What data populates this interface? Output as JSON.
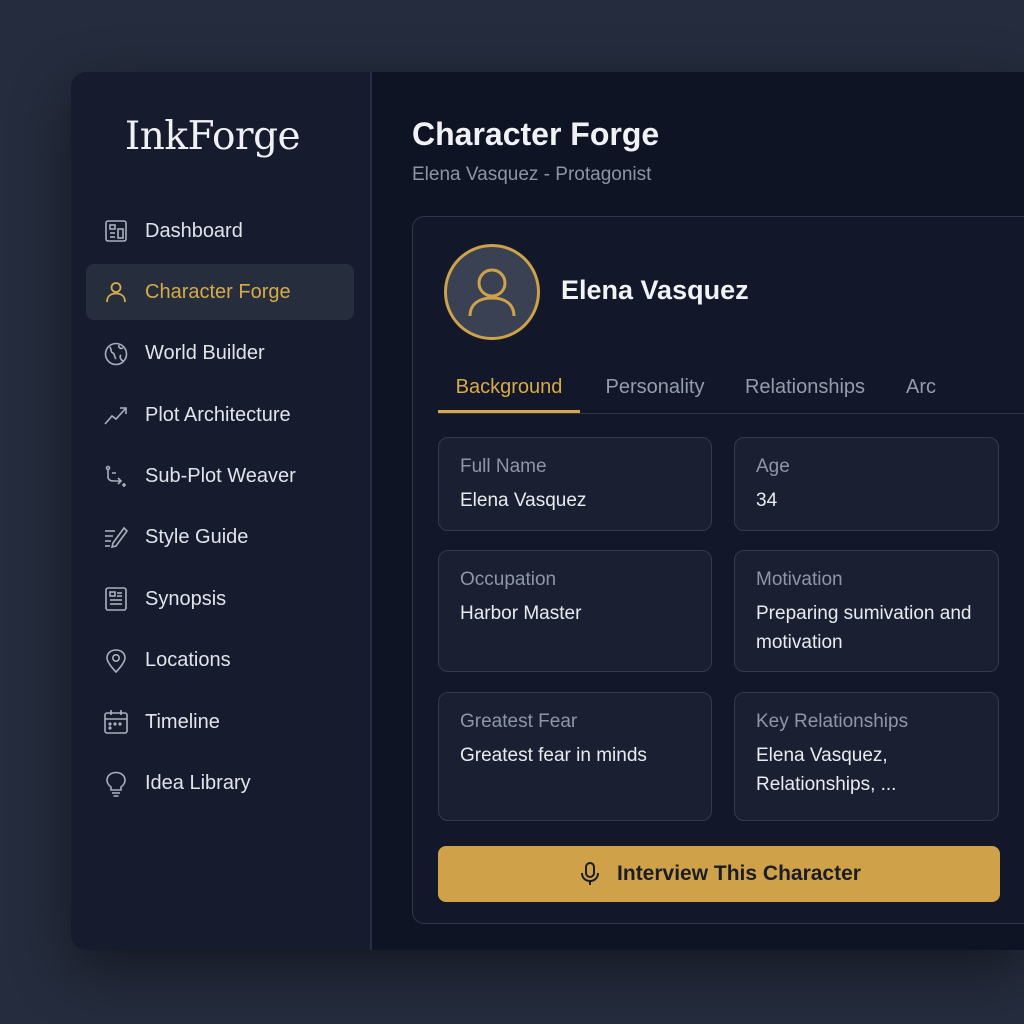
{
  "app": {
    "logo": "InkForge"
  },
  "sidebar": {
    "items": [
      {
        "label": "Dashboard",
        "icon": "dashboard-icon",
        "active": false
      },
      {
        "label": "Character Forge",
        "icon": "user-icon",
        "active": true
      },
      {
        "label": "World Builder",
        "icon": "globe-icon",
        "active": false
      },
      {
        "label": "Plot Architecture",
        "icon": "trend-line-icon",
        "active": false
      },
      {
        "label": "Sub-Plot Weaver",
        "icon": "branch-icon",
        "active": false
      },
      {
        "label": "Style Guide",
        "icon": "pen-lines-icon",
        "active": false
      },
      {
        "label": "Synopsis",
        "icon": "document-icon",
        "active": false
      },
      {
        "label": "Locations",
        "icon": "map-pin-icon",
        "active": false
      },
      {
        "label": "Timeline",
        "icon": "calendar-icon",
        "active": false
      },
      {
        "label": "Idea Library",
        "icon": "lightbulb-icon",
        "active": false
      }
    ]
  },
  "header": {
    "title": "Character Forge",
    "subtitle": "Elena Vasquez - Protagonist"
  },
  "character": {
    "name": "Elena Vasquez",
    "tabs": [
      {
        "label": "Background",
        "active": true
      },
      {
        "label": "Personality",
        "active": false
      },
      {
        "label": "Relationships",
        "active": false
      },
      {
        "label": "Arc",
        "active": false
      }
    ],
    "fields": [
      {
        "label": "Full Name",
        "value": "Elena Vasquez"
      },
      {
        "label": "Age",
        "value": "34"
      },
      {
        "label": "Occupation",
        "value": "Harbor Master"
      },
      {
        "label": "Motivation",
        "value": "Preparing sumivation and motivation"
      },
      {
        "label": "Greatest Fear",
        "value": "Greatest fear in minds"
      },
      {
        "label": "Key Relationships",
        "value": "Elena Vasquez, Relationships, ..."
      }
    ],
    "interview_label": "Interview This Character"
  },
  "colors": {
    "accent": "#cfa24a",
    "background": "#0f1424",
    "sidebar": "#161c2e"
  }
}
